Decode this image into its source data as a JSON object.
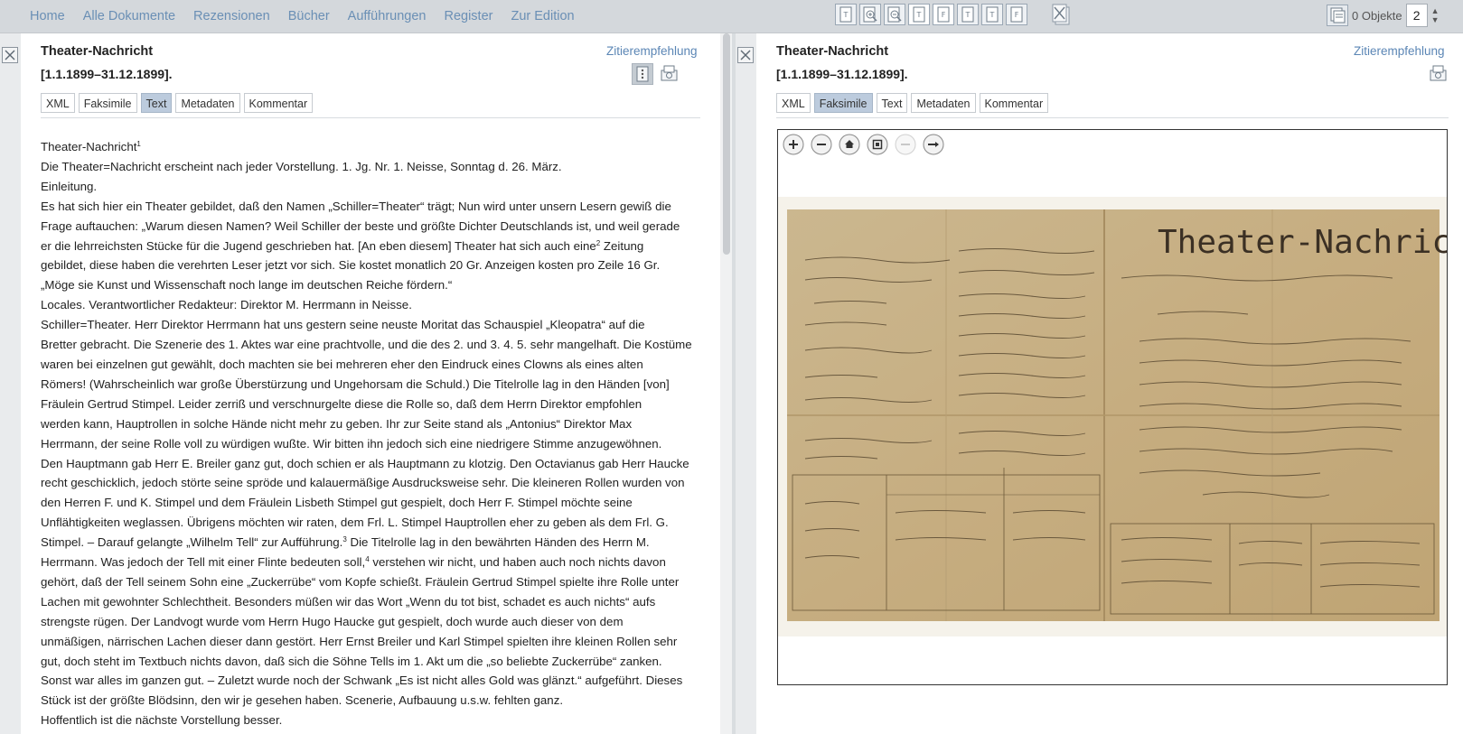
{
  "nav": {
    "items": [
      "Home",
      "Alle Dokumente",
      "Rezensionen",
      "Bücher",
      "Aufführungen",
      "Register",
      "Zur Edition"
    ]
  },
  "toolbar": {
    "objects_label": "0 Objekte",
    "page_count": "2"
  },
  "left_panel": {
    "title": "Theater-Nachricht",
    "date": "[1.1.1899–31.12.1899].",
    "cite_label": "Zitierempfehlung",
    "tabs": [
      "XML",
      "Faksimile",
      "Text",
      "Metadaten",
      "Kommentar"
    ],
    "active_tab": "Text",
    "text": {
      "l1": "Theater-Nachricht",
      "l1_sup": "1",
      "l2": "Die Theater=Nachricht erscheint nach jeder Vorstellung. 1. Jg. Nr. 1. Neisse, Sonntag d. 26. März.",
      "l3": "Einleitung.",
      "l4": "Es hat sich hier ein Theater gebildet, daß den Namen „Schiller=Theater“ trägt; Nun wird unter unsern Lesern gewiß die",
      "l5": "Frage auftauchen: „Warum diesen Namen? Weil Schiller der beste und größte Dichter Deutschlands ist, und weil gerade",
      "l6a": "er die lehrreichsten Stücke für die Jugend geschrieben hat. [An eben diesem] Theater hat sich auch eine",
      "l6_sup": "2",
      "l6b": " Zeitung",
      "l7": "gebildet, diese haben die verehrten Leser jetzt vor sich. Sie kostet monatlich 20 Gr. Anzeigen kosten pro Zeile 16 Gr.",
      "l8": "„Möge sie Kunst und Wissenschaft noch lange im deutschen Reiche fördern.“",
      "l9": "Locales. Verantwortlicher Redakteur: Direktor M. Herrmann in Neisse.",
      "l10": "Schiller=Theater. Herr Direktor Herrmann hat uns gestern seine neuste Moritat das Schauspiel „Kleopatra“ auf die",
      "l11": "Bretter gebracht. Die Szenerie des 1. Aktes war eine prachtvolle, und die des 2. und 3. 4. 5. sehr mangelhaft. Die Kostüme",
      "l12": "waren bei einzelnen gut gewählt, doch machten sie bei mehreren eher den Eindruck eines Clowns als eines alten",
      "l13": "Römers! (Wahrscheinlich war große Überstürzung und Ungehorsam die Schuld.) Die Titelrolle lag in den Händen [von]",
      "l14": "Fräulein Gertrud Stimpel. Leider zerriß und verschnurgelte diese die Rolle so, daß dem Herrn Direktor empfohlen",
      "l15": "werden kann, Hauptrollen in solche Hände nicht mehr zu geben. Ihr zur Seite stand als „Antonius“ Direktor Max",
      "l16": "Herrmann, der seine Rolle voll zu würdigen wußte. Wir bitten ihn jedoch sich eine niedrigere Stimme anzugewöhnen.",
      "l17": "Den Hauptmann gab Herr E. Breiler ganz gut, doch schien er als Hauptmann zu klotzig. Den Octavianus gab Herr Haucke",
      "l18": "recht geschicklich, jedoch störte seine spröde und kalauermäßige Ausdrucksweise sehr. Die kleineren Rollen wurden von",
      "l19": "den Herren F. und K. Stimpel und dem Fräulein Lisbeth Stimpel gut gespielt, doch Herr F. Stimpel möchte seine",
      "l20": "Unflähtigkeiten weglassen. Übrigens möchten wir raten, dem Frl. L. Stimpel Hauptrollen eher zu geben als dem Frl. G.",
      "l21a": "Stimpel. – Darauf gelangte „Wilhelm Tell“ zur Aufführung.",
      "l21_sup": "3",
      "l21b": " Die Titelrolle lag in den bewährten Händen des Herrn M.",
      "l22a": "Herrmann. Was jedoch der Tell mit einer Flinte bedeuten soll,",
      "l22_sup": "4",
      "l22b": " verstehen wir nicht, und haben auch noch nichts davon",
      "l23": "gehört, daß der Tell seinem Sohn eine „Zuckerrübe“ vom Kopfe schießt. Fräulein Gertrud Stimpel spielte ihre Rolle unter",
      "l24": "Lachen mit gewohnter Schlechtheit. Besonders müßen wir das Wort „Wenn du tot bist, schadet es auch nichts“ aufs",
      "l25": "strengste rügen. Der Landvogt wurde vom Herrn Hugo Haucke gut gespielt, doch wurde auch dieser von dem",
      "l26": "unmäßigen, närrischen Lachen dieser dann gestört. Herr Ernst Breiler und Karl Stimpel spielten ihre kleinen Rollen sehr",
      "l27": "gut, doch steht im Textbuch nichts davon, daß sich die Söhne Tells im 1. Akt um die „so beliebte Zuckerrübe“ zanken.",
      "l28": "Sonst war alles im ganzen gut. – Zuletzt wurde noch der Schwank „Es ist nicht alles Gold was glänzt.“ aufgeführt. Dieses",
      "l29": "Stück ist der größte Blödsinn, den wir je gesehen haben. Scenerie, Aufbauung u.s.w. fehlten ganz.",
      "l30": "Hoffentlich ist die nächste Vorstellung besser."
    }
  },
  "right_panel": {
    "title": "Theater-Nachricht",
    "date": "[1.1.1899–31.12.1899].",
    "cite_label": "Zitierempfehlung",
    "tabs": [
      "XML",
      "Faksimile",
      "Text",
      "Metadaten",
      "Kommentar"
    ],
    "active_tab": "Faksimile",
    "facsimile_heading": "Theater-Nachricht."
  },
  "colors": {
    "link": "#6a8fb5",
    "active_tab": "#bccbdd",
    "paper": "#c9b287"
  }
}
